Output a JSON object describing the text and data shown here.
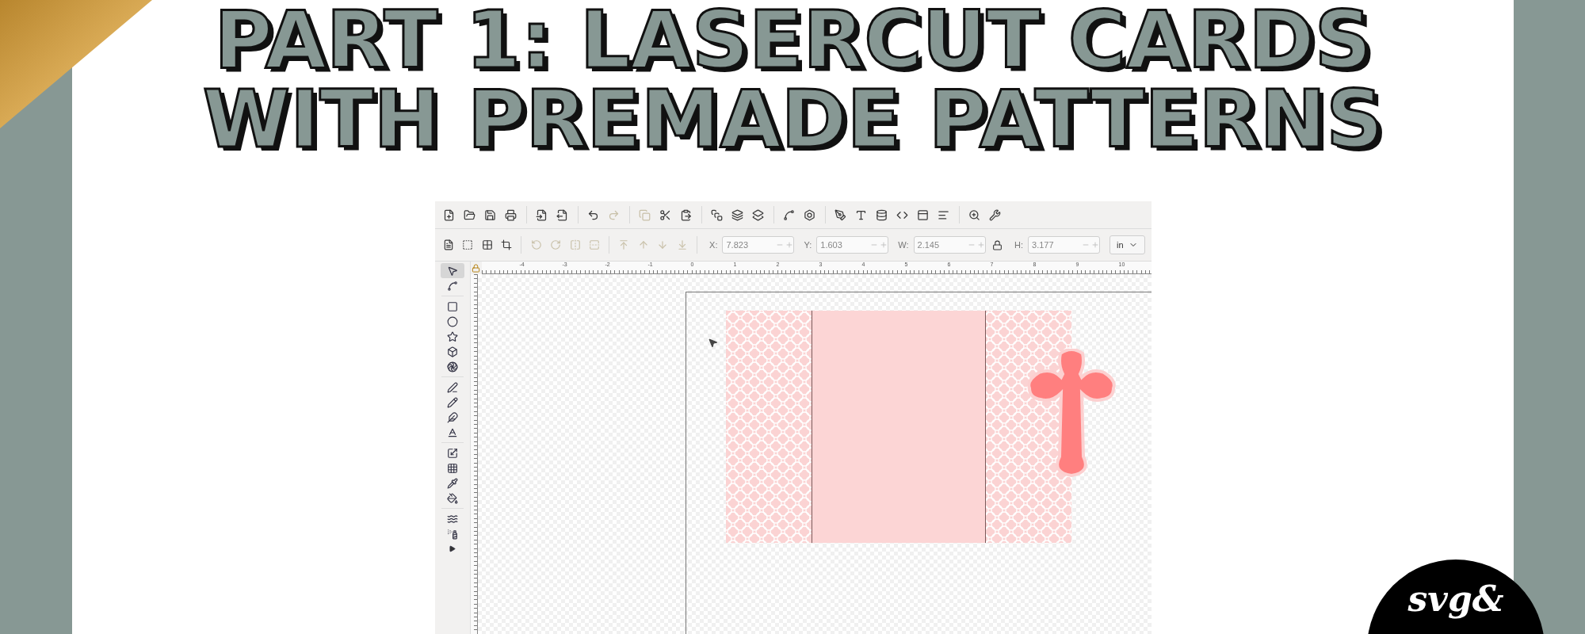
{
  "title": {
    "lines": [
      "PART 1: LASERCUT CARDS",
      "WITH PREMADE PATTERNS"
    ]
  },
  "editor": {
    "tools": [
      {
        "selected": true
      },
      {
        "selected": false
      },
      {
        "selected": false
      },
      {
        "selected": false
      },
      {
        "selected": false
      },
      {
        "selected": false
      },
      {
        "selected": false
      },
      {
        "selected": false
      },
      {
        "selected": false
      },
      {
        "selected": false
      },
      {
        "selected": false
      },
      {
        "selected": false
      },
      {
        "selected": false
      },
      {
        "selected": false
      },
      {
        "selected": false
      },
      {
        "selected": false
      },
      {
        "selected": false
      }
    ],
    "transform_fields": [
      {
        "label": "X:",
        "value": "7.823"
      },
      {
        "label": "Y:",
        "value": "1.603"
      },
      {
        "label": "W:",
        "value": "2.145"
      },
      {
        "label": "H:",
        "value": "3.177"
      }
    ],
    "unit": "in",
    "ruler_labels": [
      "-4",
      "-3",
      "-2",
      "-1",
      "0",
      "1",
      "2",
      "3",
      "4",
      "5",
      "6",
      "7",
      "8",
      "9",
      "10"
    ]
  },
  "logo": {
    "text": "svg&"
  }
}
